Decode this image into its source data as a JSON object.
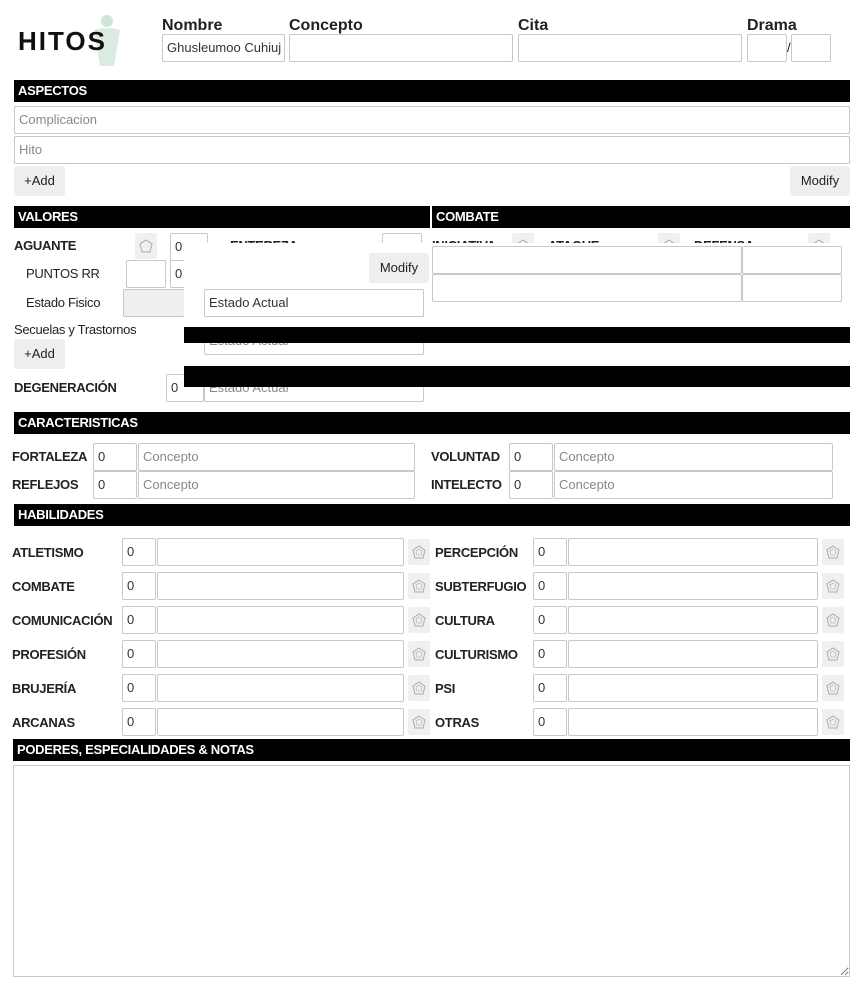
{
  "logo": {
    "text": "HITOS"
  },
  "header": {
    "name_label": "Nombre",
    "name_value": "Ghusleumoo Cuhiuj",
    "concept_label": "Concepto",
    "quote_label": "Cita",
    "drama_label": "Drama",
    "drama_separator": "/"
  },
  "aspectos": {
    "title": "ASPECTOS",
    "complicacion_placeholder": "Complicacion",
    "hito_placeholder": "Hito",
    "add_label": "+Add",
    "modify_label": "Modify"
  },
  "valores": {
    "title": "VALORES",
    "aguante_label": "AGUANTE",
    "aguante_value": "0",
    "entereza_label": "ENTEREZA",
    "puntos_rr_label": "PUNTOS RR",
    "puntos_rr_value": "0",
    "estado_fisico_label": "Estado Fisico",
    "estado_actual_text": "Estado Actual",
    "secuelas_label": "Secuelas y Trastornos",
    "add_label": "+Add",
    "modify_label": "Modify",
    "degeneracion_label": "DEGENERACIÓN",
    "degeneracion_value": "0"
  },
  "combate": {
    "title": "COMBATE",
    "iniciativa_label": "INICIATIVA",
    "ataque_label": "ATAQUE",
    "defensa_label": "DEFENSA"
  },
  "caracteristicas": {
    "title": "CARACTERISTICAS",
    "concept_placeholder": "Concepto",
    "items": [
      {
        "label": "FORTALEZA",
        "value": "0"
      },
      {
        "label": "REFLEJOS",
        "value": "0"
      },
      {
        "label": "VOLUNTAD",
        "value": "0"
      },
      {
        "label": "INTELECTO",
        "value": "0"
      }
    ]
  },
  "habilidades": {
    "title": "HABILIDADES",
    "left": [
      {
        "label": "ATLETISMO",
        "value": "0"
      },
      {
        "label": "COMBATE",
        "value": "0"
      },
      {
        "label": "COMUNICACIÓN",
        "value": "0"
      },
      {
        "label": "PROFESIÓN",
        "value": "0"
      },
      {
        "label": "BRUJERÍA",
        "value": "0"
      },
      {
        "label": "ARCANAS",
        "value": "0"
      }
    ],
    "right": [
      {
        "label": "PERCEPCIÓN",
        "value": "0"
      },
      {
        "label": "SUBTERFUGIO",
        "value": "0"
      },
      {
        "label": "CULTURA",
        "value": "0"
      },
      {
        "label": "CULTURISMO",
        "value": "0"
      },
      {
        "label": "PSI",
        "value": "0"
      },
      {
        "label": "OTRAS",
        "value": "0"
      }
    ]
  },
  "notas": {
    "title": "PODERES, ESPECIALIDADES & NOTAS"
  }
}
